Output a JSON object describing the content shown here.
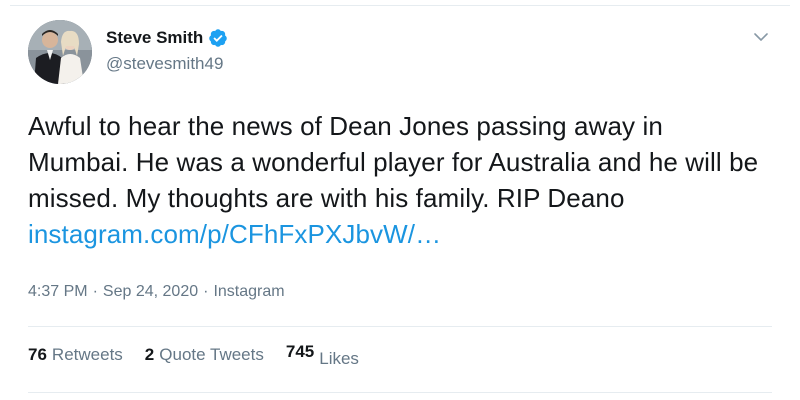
{
  "author": {
    "display_name": "Steve Smith",
    "handle": "@stevesmith49",
    "verified": true
  },
  "tweet": {
    "text": "Awful to hear the news of Dean Jones passing away in Mumbai. He was a wonderful player for Australia and he will be missed. My thoughts are with his family. RIP Deano ",
    "link_text": "instagram.com/p/CFhFxPXJbvW/…"
  },
  "meta": {
    "time": "4:37 PM",
    "separator1": "·",
    "date": "Sep 24, 2020",
    "separator2": "·",
    "source": "Instagram"
  },
  "stats": {
    "retweets_count": "76",
    "retweets_label": "Retweets",
    "quotes_count": "2",
    "quotes_label": "Quote Tweets",
    "likes_count": "745",
    "likes_label": "Likes"
  },
  "colors": {
    "link": "#1b95e0",
    "secondary_text": "#657786",
    "verified_badge": "#1da1f2"
  },
  "icons": {
    "verified": "verified-badge-icon",
    "caret": "chevron-down-icon"
  }
}
